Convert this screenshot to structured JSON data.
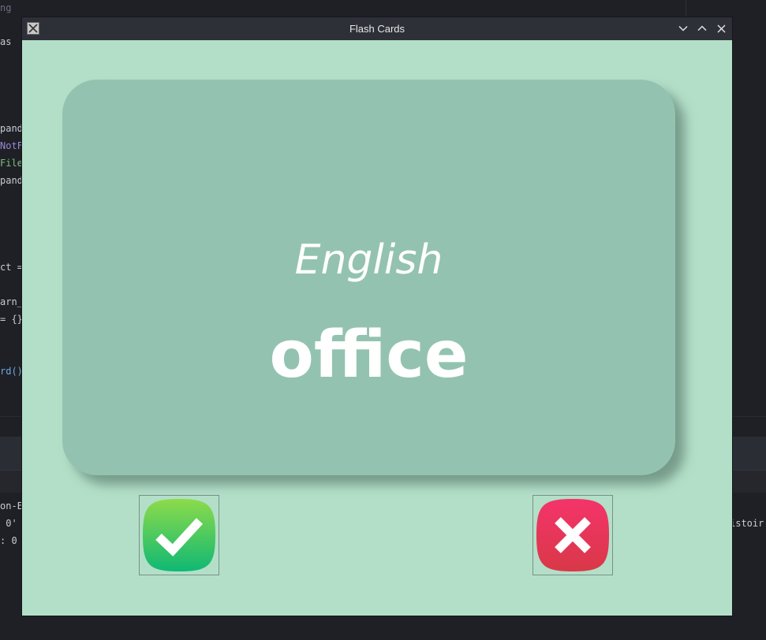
{
  "background_editor": {
    "lines": [
      {
        "text": "ng",
        "color": "#6c7180"
      },
      {
        "text": "as",
        "color": "#c9ccd4"
      },
      {
        "text": "pand",
        "color": "#c9ccd4"
      },
      {
        "text": "NotF",
        "color": "#9b87d6"
      },
      {
        "text": "File",
        "color": "#7fbf7f"
      },
      {
        "text": "pand",
        "color": "#c9ccd4"
      },
      {
        "text": "ct =",
        "color": "#c9ccd4"
      },
      {
        "text": "arn_",
        "color": "#c9ccd4"
      },
      {
        "text": "= {}",
        "color": "#c9ccd4"
      },
      {
        "text": "rd()",
        "color": "#6fa8dc"
      },
      {
        "text": "on-E",
        "color": "#c9ccd4"
      },
      {
        "text": " 0'",
        "color": "#c9ccd4"
      },
      {
        "text": ": 0",
        "color": "#c9ccd4"
      },
      {
        "text": "istoir",
        "color": "#c9ccd4"
      }
    ]
  },
  "window": {
    "title": "Flash Cards",
    "controls": {
      "minimize_icon": "chevron-down-icon",
      "maximize_icon": "chevron-up-icon",
      "close_icon": "close-icon"
    }
  },
  "card": {
    "language": "English",
    "word": "office",
    "color": "#93c3b0"
  },
  "buttons": {
    "right_icon": "checkmark-icon",
    "wrong_icon": "cross-icon"
  },
  "colors": {
    "window_background": "#b3dfc8",
    "card_background": "#93c3b0",
    "right_gradient_top": "#8ddb4a",
    "right_gradient_bottom": "#0fb874",
    "wrong_gradient_top": "#f4346a",
    "wrong_gradient_bottom": "#d93848"
  }
}
